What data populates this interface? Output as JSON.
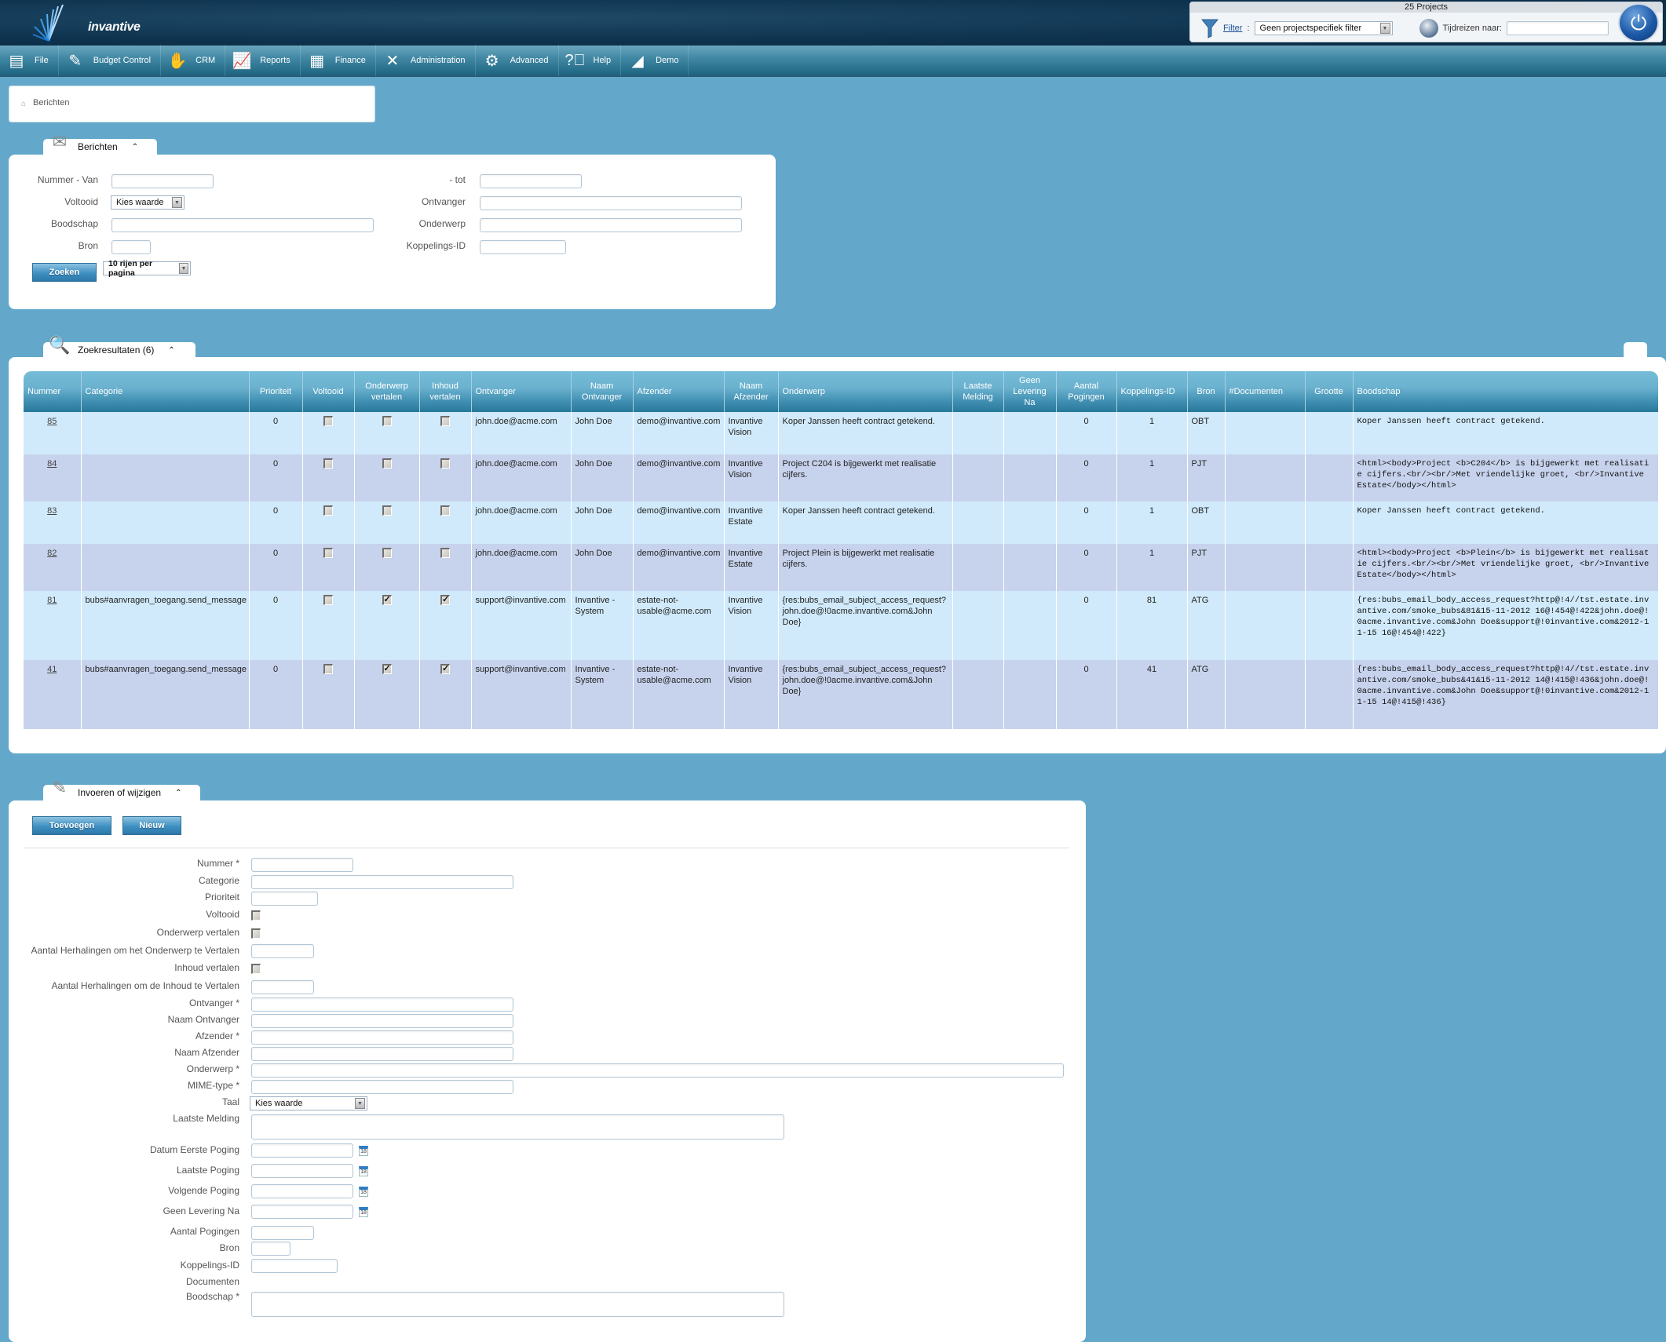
{
  "header": {
    "brand": "invantive",
    "projects_title": "25 Projects",
    "filter_label": "Filter",
    "filter_separator": ":",
    "filter_value": "Geen projectspecifiek filter",
    "time_travel_label": "Tijdreizen naar:",
    "time_travel_value": ""
  },
  "nav": {
    "items": [
      {
        "label": "File",
        "icon": "file-cabinet-icon"
      },
      {
        "label": "Budget Control",
        "icon": "budget-icon"
      },
      {
        "label": "CRM",
        "icon": "handshake-icon"
      },
      {
        "label": "Reports",
        "icon": "presentation-chart-icon"
      },
      {
        "label": "Finance",
        "icon": "calculator-icon"
      },
      {
        "label": "Administration",
        "icon": "tools-icon"
      },
      {
        "label": "Advanced",
        "icon": "gears-icon"
      },
      {
        "label": "Help",
        "icon": "help-icon"
      },
      {
        "label": "Demo",
        "icon": "demo-logo-icon"
      }
    ]
  },
  "breadcrumb": {
    "label": "Berichten"
  },
  "search_panel": {
    "title": "Berichten",
    "labels": {
      "nummer_van": "Nummer - Van",
      "tot": "- tot",
      "voltooid": "Voltooid",
      "ontvanger": "Ontvanger",
      "boodschap": "Boodschap",
      "onderwerp": "Onderwerp",
      "bron": "Bron",
      "koppelings_id": "Koppelings-ID"
    },
    "voltooid_value": "Kies waarde",
    "search_button": "Zoeken",
    "page_size_value": "10 rijen per pagina"
  },
  "results_panel": {
    "title": "Zoekresultaten (6)",
    "columns": [
      "Nummer",
      "Categorie",
      "Prioriteit",
      "Voltooid",
      "Onderwerp vertalen",
      "Inhoud vertalen",
      "Ontvanger",
      "Naam Ontvanger",
      "Afzender",
      "Naam Afzender",
      "Onderwerp",
      "Laatste Melding",
      "Geen Levering Na",
      "Aantal Pogingen",
      "Koppelings-ID",
      "Bron",
      "#Documenten",
      "Grootte",
      "Boodschap"
    ],
    "rows": [
      {
        "nummer": "85",
        "categorie": "",
        "prioriteit": "0",
        "voltooid": false,
        "onderwerp_vertalen": false,
        "inhoud_vertalen": false,
        "ontvanger": "john.doe@acme.com",
        "naam_ontvanger": "John Doe",
        "afzender": "demo@invantive.com",
        "naam_afzender": "Invantive Vision",
        "onderwerp": "Koper Janssen heeft contract getekend.",
        "laatste_melding": "",
        "geen_levering_na": "",
        "aantal_pogingen": "0",
        "koppelings_id": "1",
        "bron": "OBT",
        "documenten": "",
        "grootte": "",
        "boodschap": "Koper Janssen heeft contract getekend."
      },
      {
        "nummer": "84",
        "categorie": "",
        "prioriteit": "0",
        "voltooid": false,
        "onderwerp_vertalen": false,
        "inhoud_vertalen": false,
        "ontvanger": "john.doe@acme.com",
        "naam_ontvanger": "John Doe",
        "afzender": "demo@invantive.com",
        "naam_afzender": "Invantive Vision",
        "onderwerp": "Project C204 is bijgewerkt met realisatie cijfers.",
        "laatste_melding": "",
        "geen_levering_na": "",
        "aantal_pogingen": "0",
        "koppelings_id": "1",
        "bron": "PJT",
        "documenten": "",
        "grootte": "",
        "boodschap": "<html><body>Project <b>C204</b> is bijgewerkt met realisatie cijfers.<br/><br/>Met vriendelijke groet, <br/>Invantive Estate</body></html>"
      },
      {
        "nummer": "83",
        "categorie": "",
        "prioriteit": "0",
        "voltooid": false,
        "onderwerp_vertalen": false,
        "inhoud_vertalen": false,
        "ontvanger": "john.doe@acme.com",
        "naam_ontvanger": "John Doe",
        "afzender": "demo@invantive.com",
        "naam_afzender": "Invantive Estate",
        "onderwerp": "Koper Janssen heeft contract getekend.",
        "laatste_melding": "",
        "geen_levering_na": "",
        "aantal_pogingen": "0",
        "koppelings_id": "1",
        "bron": "OBT",
        "documenten": "",
        "grootte": "",
        "boodschap": "Koper Janssen heeft contract getekend."
      },
      {
        "nummer": "82",
        "categorie": "",
        "prioriteit": "0",
        "voltooid": false,
        "onderwerp_vertalen": false,
        "inhoud_vertalen": false,
        "ontvanger": "john.doe@acme.com",
        "naam_ontvanger": "John Doe",
        "afzender": "demo@invantive.com",
        "naam_afzender": "Invantive Estate",
        "onderwerp": "Project Plein is bijgewerkt met realisatie cijfers.",
        "laatste_melding": "",
        "geen_levering_na": "",
        "aantal_pogingen": "0",
        "koppelings_id": "1",
        "bron": "PJT",
        "documenten": "",
        "grootte": "",
        "boodschap": "<html><body>Project <b>Plein</b> is bijgewerkt met realisatie cijfers.<br/><br/>Met vriendelijke groet, <br/>Invantive Estate</body></html>"
      },
      {
        "nummer": "81",
        "categorie": "bubs#aanvragen_toegang.send_message",
        "prioriteit": "0",
        "voltooid": false,
        "onderwerp_vertalen": true,
        "inhoud_vertalen": true,
        "ontvanger": "support@invantive.com",
        "naam_ontvanger": "Invantive - System",
        "afzender": "estate-not-usable@acme.com",
        "naam_afzender": "Invantive Vision",
        "onderwerp": "{res:bubs_email_subject_access_request?john.doe@!0acme.invantive.com&John Doe}",
        "laatste_melding": "",
        "geen_levering_na": "",
        "aantal_pogingen": "0",
        "koppelings_id": "81",
        "bron": "ATG",
        "documenten": "",
        "grootte": "",
        "boodschap": "{res:bubs_email_body_access_request?http@!4//tst.estate.invantive.com/smoke_bubs&81&15-11-2012 16@!454@!422&john.doe@!0acme.invantive.com&John Doe&support@!0invantive.com&2012-11-15 16@!454@!422}"
      },
      {
        "nummer": "41",
        "categorie": "bubs#aanvragen_toegang.send_message",
        "prioriteit": "0",
        "voltooid": false,
        "onderwerp_vertalen": true,
        "inhoud_vertalen": true,
        "ontvanger": "support@invantive.com",
        "naam_ontvanger": "Invantive - System",
        "afzender": "estate-not-usable@acme.com",
        "naam_afzender": "Invantive Vision",
        "onderwerp": "{res:bubs_email_subject_access_request?john.doe@!0acme.invantive.com&John Doe}",
        "laatste_melding": "",
        "geen_levering_na": "",
        "aantal_pogingen": "0",
        "koppelings_id": "41",
        "bron": "ATG",
        "documenten": "",
        "grootte": "",
        "boodschap": "{res:bubs_email_body_access_request?http@!4//tst.estate.invantive.com/smoke_bubs&41&15-11-2012 14@!415@!436&john.doe@!0acme.invantive.com&John Doe&support@!0invantive.com&2012-11-15 14@!415@!436}"
      }
    ]
  },
  "edit_panel": {
    "title": "Invoeren of wijzigen",
    "add_button": "Toevoegen",
    "new_button": "Nieuw",
    "labels": {
      "nummer": "Nummer *",
      "categorie": "Categorie",
      "prioriteit": "Prioriteit",
      "voltooid": "Voltooid",
      "onderwerp_vertalen": "Onderwerp vertalen",
      "herhalingen_onderwerp": "Aantal Herhalingen om het Onderwerp te Vertalen",
      "inhoud_vertalen": "Inhoud vertalen",
      "herhalingen_inhoud": "Aantal Herhalingen om de Inhoud te Vertalen",
      "ontvanger": "Ontvanger *",
      "naam_ontvanger": "Naam Ontvanger",
      "afzender": "Afzender *",
      "naam_afzender": "Naam Afzender",
      "onderwerp": "Onderwerp *",
      "mime_type": "MIME-type *",
      "taal": "Taal",
      "laatste_melding": "Laatste Melding",
      "datum_eerste_poging": "Datum Eerste Poging",
      "laatste_poging": "Laatste Poging",
      "volgende_poging": "Volgende Poging",
      "geen_levering_na": "Geen Levering Na",
      "aantal_pogingen": "Aantal Pogingen",
      "bron": "Bron",
      "koppelings_id": "Koppelings-ID",
      "documenten": "Documenten",
      "boodschap": "Boodschap *"
    },
    "taal_value": "Kies waarde",
    "calendar_day": "18"
  }
}
